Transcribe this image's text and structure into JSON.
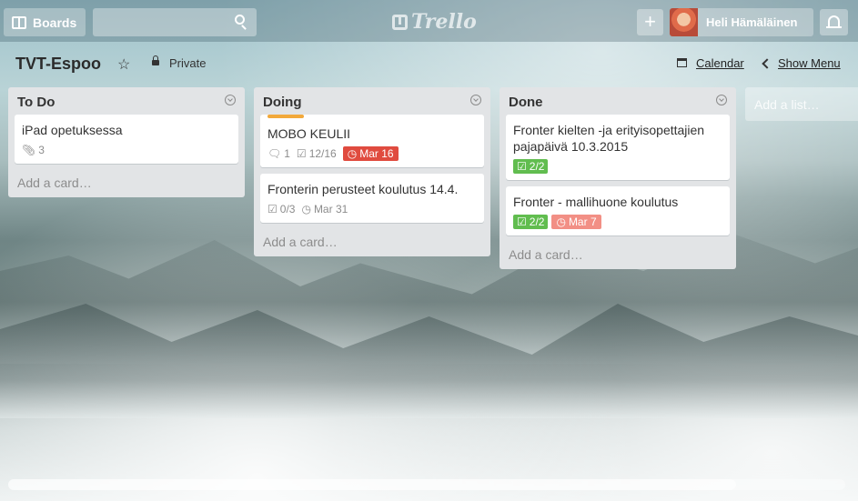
{
  "header": {
    "boards_label": "Boards",
    "search_placeholder": "",
    "logo_text": "Trello",
    "plus_label": "+",
    "user_name": "Heli Hämäläinen"
  },
  "board": {
    "title": "TVT-Espoo",
    "privacy": "Private",
    "calendar_label": "Calendar",
    "show_menu_label": "Show Menu"
  },
  "lists": [
    {
      "name": "To Do",
      "add_card": "Add a card…",
      "cards": [
        {
          "title": "iPad opetuksessa",
          "attachments": "3"
        }
      ]
    },
    {
      "name": "Doing",
      "add_card": "Add a card…",
      "cards": [
        {
          "title": "MOBO KEULII",
          "comments": "1",
          "checklist": "12/16",
          "due": "Mar 16",
          "label_color": "#f2a93b"
        },
        {
          "title": "Fronterin perusteet koulutus 14.4.",
          "checklist": "0/3",
          "due": "Mar 31"
        }
      ]
    },
    {
      "name": "Done",
      "add_card": "Add a card…",
      "cards": [
        {
          "title": "Fronter kielten -ja erityisopettajien pajapäivä 10.3.2015",
          "checklist": "2/2"
        },
        {
          "title": "Fronter - mallihuone koulutus",
          "checklist": "2/2",
          "due": "Mar 7"
        }
      ]
    }
  ],
  "add_list_placeholder": "Add a list…",
  "colors": {
    "due_overdue": "#e04b3f",
    "due_past": "#f28f85",
    "checklist_complete": "#61bd4f",
    "list_background": "#e2e4e6"
  },
  "icons": [
    "boards-icon",
    "search-icon",
    "trello-logo-icon",
    "plus-icon",
    "avatar",
    "bell-icon",
    "star-icon",
    "lock-icon",
    "calendar-icon",
    "chevron-left-icon",
    "list-menu-icon",
    "attachment-icon",
    "comment-icon",
    "checklist-icon",
    "clock-icon"
  ]
}
